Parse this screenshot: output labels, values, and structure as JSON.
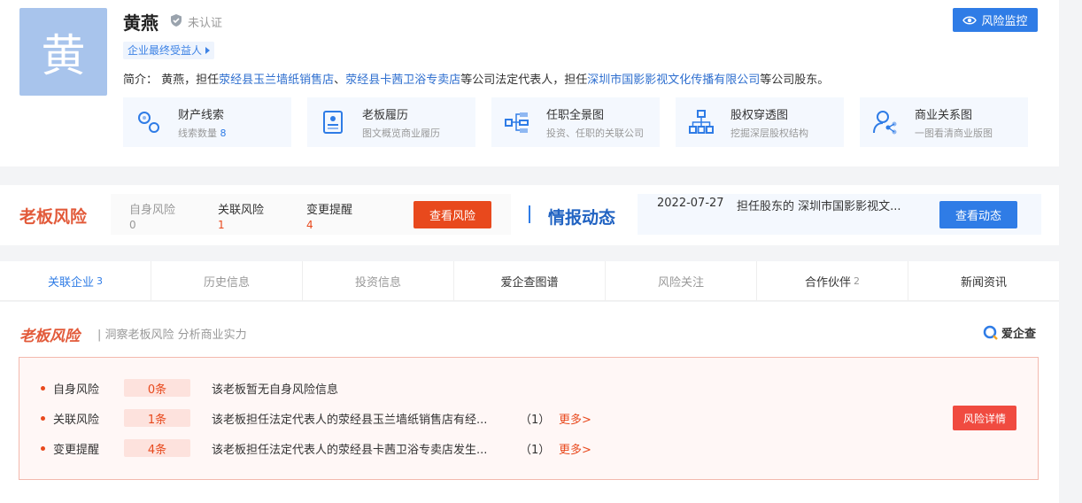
{
  "profile": {
    "avatar_char": "黄",
    "name": "黄燕",
    "verify_status": "未认证",
    "tag": "企业最终受益人",
    "monitor_label": "风险监控",
    "intro": {
      "prefix": "简介：",
      "p1": " 黄燕，担任",
      "link1": "荥经县玉兰墙纸销售店",
      "sep": "、",
      "link2": "荥经县卡茜卫浴专卖店",
      "p2": "等公司法定代表人，担任",
      "link3": "深圳市国影影视文化传播有限公司",
      "p3": "等公司股东。"
    },
    "features": [
      {
        "title": "财产线索",
        "sub": "线索数量",
        "num": "8",
        "icon": "property-icon"
      },
      {
        "title": "老板履历",
        "sub": "图文概览商业履历",
        "icon": "resume-icon"
      },
      {
        "title": "任职全景图",
        "sub": "投资、任职的关联公司",
        "icon": "panorama-icon"
      },
      {
        "title": "股权穿透图",
        "sub": "挖掘深层股权结构",
        "icon": "equity-icon"
      },
      {
        "title": "商业关系图",
        "sub": "一图看清商业版图",
        "icon": "relation-icon"
      }
    ]
  },
  "risk_bar": {
    "title": "老板风险",
    "cols": [
      {
        "label": "自身风险",
        "value": "0"
      },
      {
        "label": "关联风险",
        "value": "1"
      },
      {
        "label": "变更提醒",
        "value": "4"
      }
    ],
    "button": "查看风险"
  },
  "intel": {
    "title": "情报动态",
    "date": "2022-07-27",
    "text": "担任股东的 深圳市国影影视文...",
    "button": "查看动态"
  },
  "tabs": [
    {
      "label": "关联企业",
      "count": "3",
      "state": "active"
    },
    {
      "label": "历史信息",
      "count": "",
      "state": "muted"
    },
    {
      "label": "投资信息",
      "count": "",
      "state": "muted"
    },
    {
      "label": "爱企查图谱",
      "count": "",
      "state": "normal"
    },
    {
      "label": "风险关注",
      "count": "",
      "state": "muted"
    },
    {
      "label": "合作伙伴",
      "count": "2",
      "state": "normal"
    },
    {
      "label": "新闻资讯",
      "count": "",
      "state": "normal"
    }
  ],
  "section": {
    "title": "老板风险",
    "subtitle": "| 洞察老板风险 分析商业实力",
    "brand": "爱企查",
    "rows": [
      {
        "label": "自身风险",
        "pill": "0条",
        "text": "该老板暂无自身风险信息",
        "count": "",
        "more": ""
      },
      {
        "label": "关联风险",
        "pill": "1条",
        "text": "该老板担任法定代表人的荥经县玉兰墙纸销售店有经...",
        "count": "（1）",
        "more": "更多>"
      },
      {
        "label": "变更提醒",
        "pill": "4条",
        "text": "该老板担任法定代表人的荥经县卡茜卫浴专卖店发生...",
        "count": "（1）",
        "more": "更多>"
      }
    ],
    "detail_button": "风险详情"
  },
  "colors": {
    "primary": "#2f7ce6",
    "risk": "#e8491d",
    "risk_title": "#e25a3a"
  }
}
